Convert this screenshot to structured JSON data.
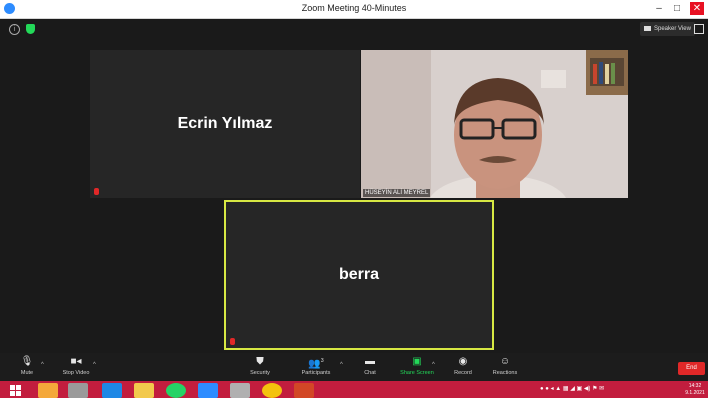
{
  "window": {
    "title": "Zoom Meeting 40-Minutes",
    "minimize": "–",
    "restore": "□",
    "close": "✕"
  },
  "header": {
    "speaker_view_label": "Speaker View"
  },
  "participants": [
    {
      "name": "Ecrin Yılmaz"
    },
    {
      "name": "HÜSEYİN ALİ MEYREL"
    },
    {
      "name": "berra"
    }
  ],
  "toolbar": {
    "mute": "Mute",
    "stop_video": "Stop Video",
    "security": "Security",
    "participants": "Participants",
    "participants_count": "3",
    "chat": "Chat",
    "share_screen": "Share Screen",
    "record": "Record",
    "reactions": "Reactions",
    "end": "End"
  },
  "taskbar": {
    "time": "14:32",
    "date": "9.1.2021"
  },
  "colors": {
    "active_speaker_border": "#d7e843",
    "share_green": "#23d959",
    "end_red": "#e02828",
    "taskbar": "#c21d3e"
  }
}
